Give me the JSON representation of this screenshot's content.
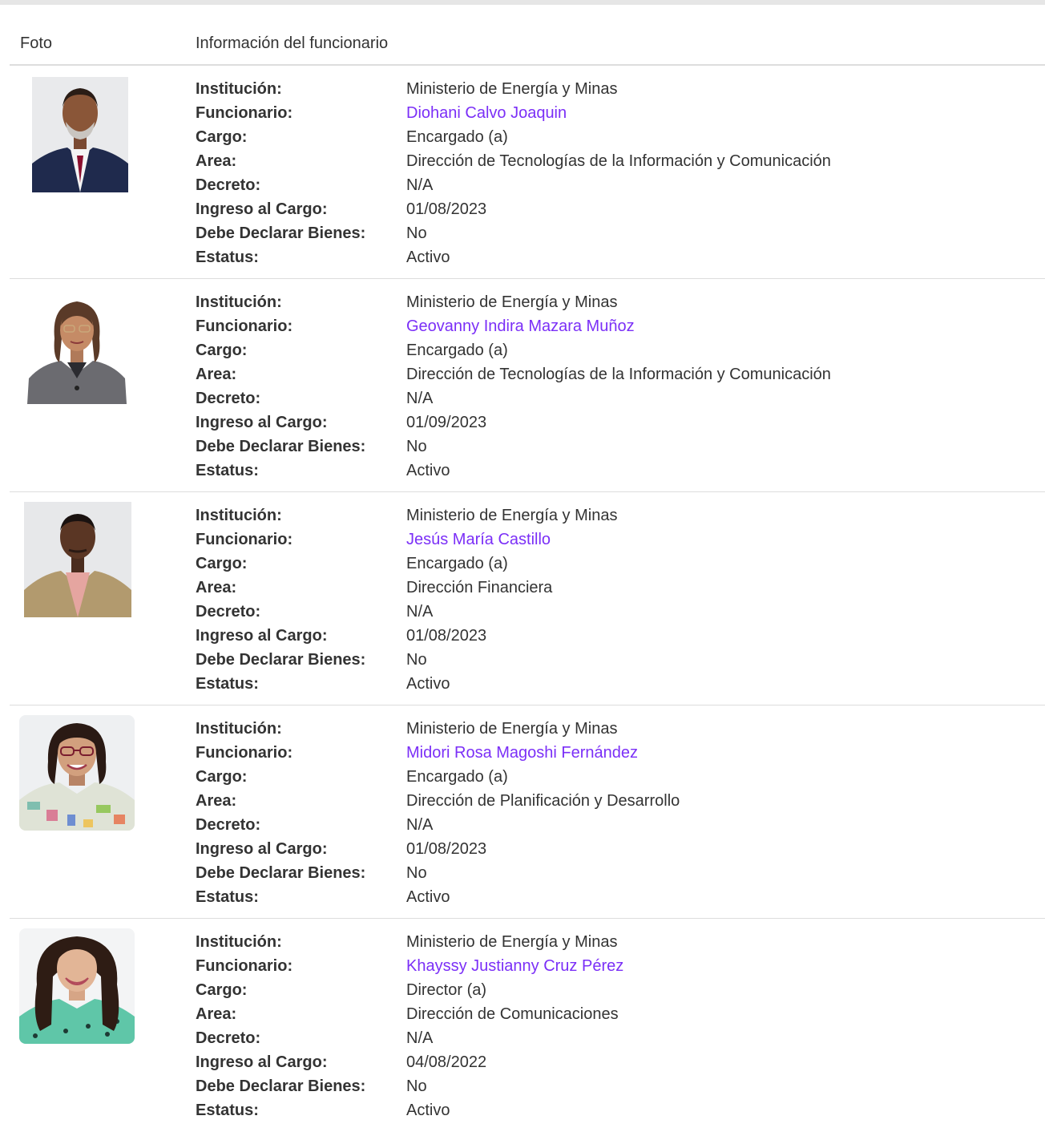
{
  "table": {
    "headers": {
      "photo": "Foto",
      "info": "Información del funcionario"
    },
    "labels": {
      "institucion": "Institución:",
      "funcionario": "Funcionario:",
      "cargo": "Cargo:",
      "area": "Area:",
      "decreto": "Decreto:",
      "ingreso": "Ingreso al Cargo:",
      "declarar": "Debe Declarar Bienes:",
      "estatus": "Estatus:"
    },
    "rows": [
      {
        "institucion": "Ministerio de Energía y Minas",
        "funcionario": "Diohani Calvo Joaquin",
        "cargo": "Encargado (a)",
        "area": "Dirección de Tecnologías de la Información y Comunicación",
        "decreto": "N/A",
        "ingreso": "01/08/2023",
        "declarar": "No",
        "estatus": "Activo"
      },
      {
        "institucion": "Ministerio de Energía y Minas",
        "funcionario": "Geovanny Indira Mazara Muñoz",
        "cargo": "Encargado (a)",
        "area": "Dirección de Tecnologías de la Información y Comunicación",
        "decreto": "N/A",
        "ingreso": "01/09/2023",
        "declarar": "No",
        "estatus": "Activo"
      },
      {
        "institucion": "Ministerio de Energía y Minas",
        "funcionario": "Jesús María Castillo",
        "cargo": "Encargado (a)",
        "area": "Dirección Financiera",
        "decreto": "N/A",
        "ingreso": "01/08/2023",
        "declarar": "No",
        "estatus": "Activo"
      },
      {
        "institucion": "Ministerio de Energía y Minas",
        "funcionario": "Midori Rosa Magoshi Fernández",
        "cargo": "Encargado (a)",
        "area": "Dirección de Planificación y Desarrollo",
        "decreto": "N/A",
        "ingreso": "01/08/2023",
        "declarar": "No",
        "estatus": "Activo"
      },
      {
        "institucion": "Ministerio de Energía y Minas",
        "funcionario": "Khayssy Justianny Cruz Pérez",
        "cargo": "Director (a)",
        "area": "Dirección de Comunicaciones",
        "decreto": "N/A",
        "ingreso": "04/08/2022",
        "declarar": "No",
        "estatus": "Activo"
      }
    ]
  },
  "colors": {
    "link": "#7b2ff7",
    "text": "#333333",
    "divider": "#dddddd"
  }
}
